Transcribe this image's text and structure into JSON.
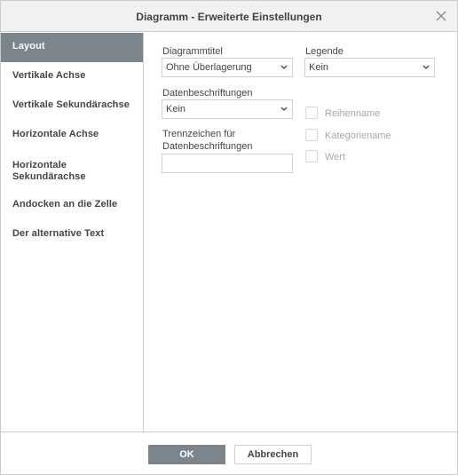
{
  "dialog": {
    "title": "Diagramm - Erweiterte Einstellungen",
    "close_icon": "close-icon"
  },
  "sidebar": {
    "items": [
      {
        "label": "Layout",
        "active": true
      },
      {
        "label": "Vertikale Achse"
      },
      {
        "label": "Vertikale Sekundärachse"
      },
      {
        "label": "Horizontale Achse"
      },
      {
        "label": "Horizontale Sekundärachse",
        "line1": "Horizontale",
        "line2": "Sekundärachse"
      },
      {
        "label": "Andocken an die Zelle"
      },
      {
        "label": "Der alternative Text"
      }
    ]
  },
  "layout": {
    "chart_title_label": "Diagrammtitel",
    "chart_title_value": "Ohne Überlagerung",
    "legend_label": "Legende",
    "legend_value": "Kein",
    "data_labels_label": "Datenbeschriftungen",
    "data_labels_value": "Kein",
    "separator_label_line1": "Trennzeichen für",
    "separator_label_line2": "Datenbeschriftungen",
    "separator_value": "",
    "checkboxes": {
      "series_name": "Reihenname",
      "category_name": "Kategoriename",
      "value": "Wert"
    }
  },
  "footer": {
    "ok_label": "OK",
    "cancel_label": "Abbrechen"
  },
  "colors": {
    "accent": "#7d858c",
    "border": "#cbcbcb",
    "text": "#444444",
    "disabled_text": "#a8a8a8"
  }
}
